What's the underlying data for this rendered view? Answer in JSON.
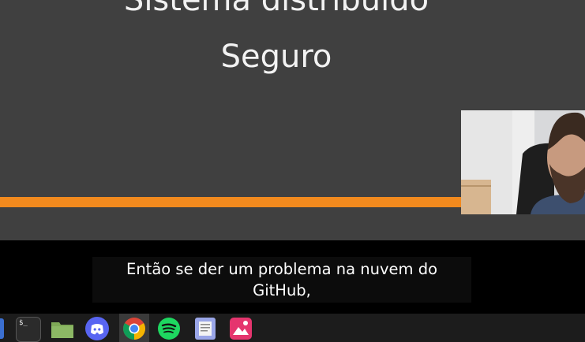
{
  "slide": {
    "title_line1": "Sistema distribuído",
    "title_line2": "Seguro",
    "accent_color": "#f28a1e"
  },
  "subtitle": {
    "line1": "Então se der um problema na nuvem do",
    "line2": "GitHub,"
  },
  "dock": {
    "items": [
      {
        "name": "terminal-icon"
      },
      {
        "name": "files-icon"
      },
      {
        "name": "discord-icon"
      },
      {
        "name": "chrome-icon"
      },
      {
        "name": "spotify-icon"
      },
      {
        "name": "text-editor-icon"
      },
      {
        "name": "image-viewer-icon"
      }
    ],
    "terminal_glyph": "$_"
  }
}
